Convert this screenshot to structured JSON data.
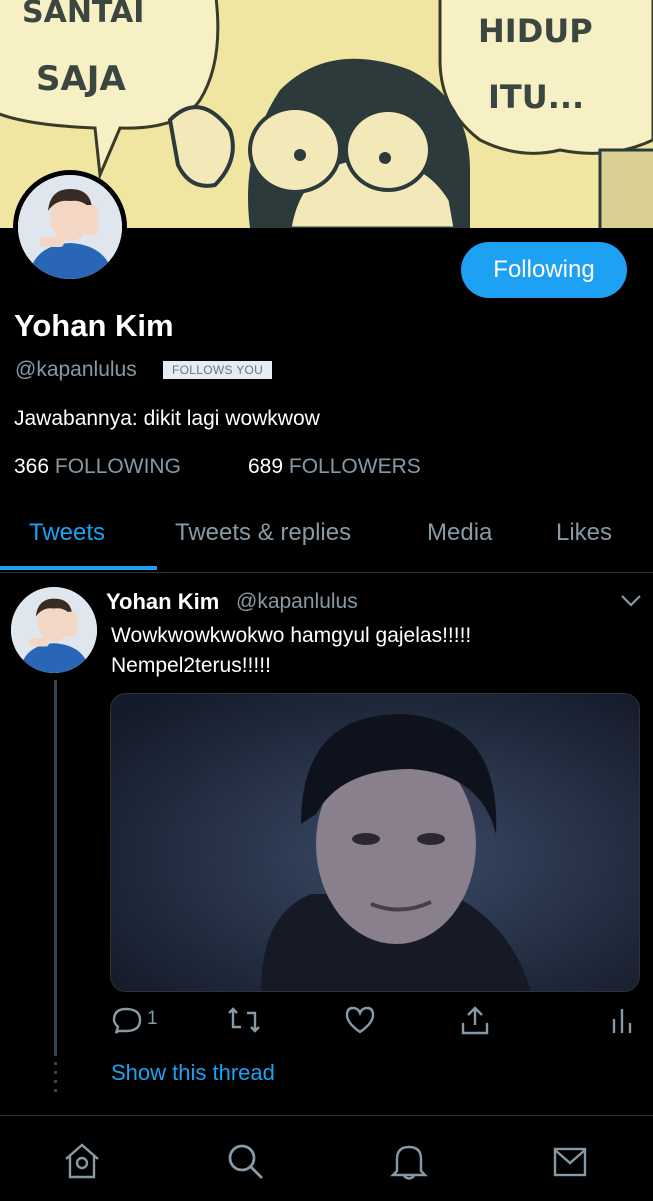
{
  "banner": {
    "bubble_left_text_1": "SANTAI",
    "bubble_left_text_2": "SAJA",
    "bubble_right_text_1": "HIDUP",
    "bubble_right_text_2": "ITU..."
  },
  "profile": {
    "name": "Yohan Kim",
    "handle": "@kapanlulus",
    "follows_you_label": "FOLLOWS YOU",
    "follow_button_label": "Following",
    "bio": "Jawabannya: dikit lagi wowkwow",
    "following_count": "366",
    "following_label": "FOLLOWING",
    "followers_count": "689",
    "followers_label": "FOLLOWERS"
  },
  "tabs": [
    {
      "label": "Tweets",
      "active": true
    },
    {
      "label": "Tweets & replies",
      "active": false
    },
    {
      "label": "Media",
      "active": false
    },
    {
      "label": "Likes",
      "active": false
    }
  ],
  "tweet": {
    "author_name": "Yohan Kim",
    "author_handle": "@kapanlulus",
    "text_line_1": "Wowkwowkwokwo hamgyul gajelas!!!!!",
    "text_line_2": "Nempel2terus!!!!!",
    "reply_count": "1",
    "show_thread_label": "Show this thread"
  },
  "colors": {
    "accent": "#1da1f2",
    "background": "#000000",
    "secondary_text": "#8899a6"
  },
  "icons": {
    "reply": "reply-icon",
    "retweet": "retweet-icon",
    "like": "heart-icon",
    "share": "share-icon",
    "analytics": "analytics-icon",
    "home": "home-icon",
    "search": "search-icon",
    "notifications": "bell-icon",
    "messages": "mail-icon"
  }
}
